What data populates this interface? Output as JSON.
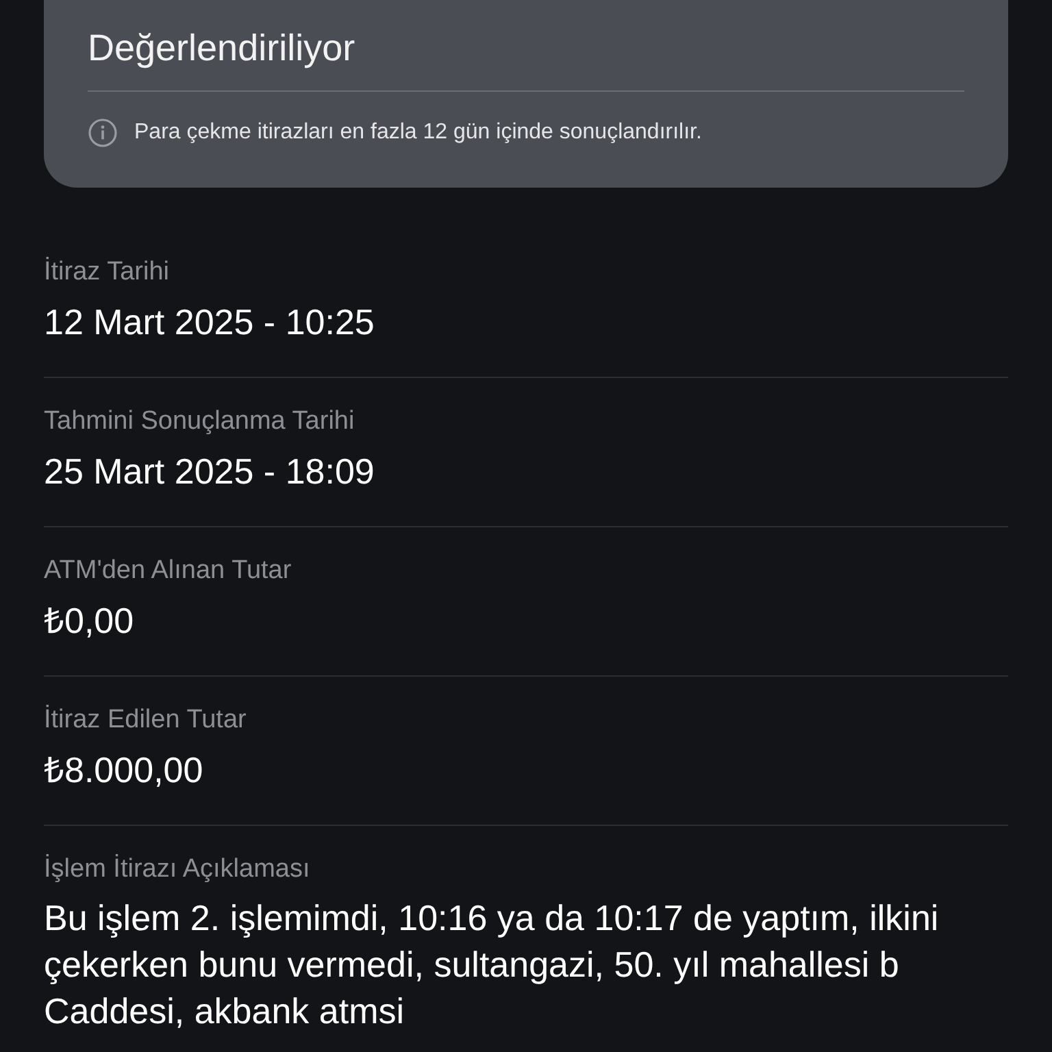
{
  "status_card": {
    "title": "Değerlendiriliyor",
    "info": "Para çekme itirazları en fazla 12 gün içinde sonuçlandırılır."
  },
  "fields": [
    {
      "label": "İtiraz Tarihi",
      "value": "12 Mart 2025 - 10:25"
    },
    {
      "label": "Tahmini Sonuçlanma Tarihi",
      "value": "25 Mart 2025 - 18:09"
    },
    {
      "label": "ATM'den Alınan Tutar",
      "value": "₺0,00"
    },
    {
      "label": "İtiraz Edilen Tutar",
      "value": "₺8.000,00"
    }
  ],
  "description": {
    "label": "İşlem İtirazı Açıklaması",
    "text": "Bu işlem 2. işlemimdi, 10:16 ya da 10:17 de yaptım, ilkini çekerken bunu vermedi, sultangazi, 50. yıl mahallesi b Caddesi, akbank atmsi"
  }
}
